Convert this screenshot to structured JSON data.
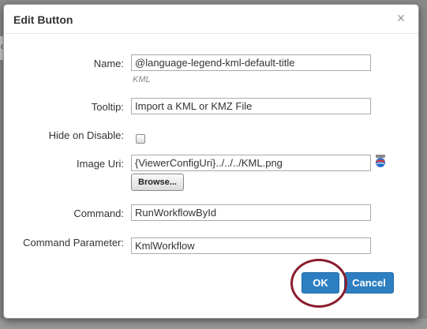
{
  "dialog": {
    "title": "Edit Button",
    "close_glyph": "×"
  },
  "fields": {
    "name": {
      "label": "Name:",
      "value": "@language-legend-kml-default-title",
      "hint": "KML"
    },
    "tooltip": {
      "label": "Tooltip:",
      "value": "Import a KML or KMZ File"
    },
    "hide_on_disable": {
      "label": "Hide on Disable:",
      "checked": false
    },
    "image_uri": {
      "label": "Image Uri:",
      "value": "{ViewerConfigUri}../../../KML.png",
      "browse_label": "Browse..."
    },
    "command": {
      "label": "Command:",
      "value": "RunWorkflowById"
    },
    "command_parameter": {
      "label": "Command Parameter:",
      "value": "KmlWorkflow"
    }
  },
  "buttons": {
    "ok_label": "OK",
    "cancel_label": "Cancel"
  },
  "colors": {
    "primary_button": "#2d7fc2",
    "highlight_circle": "#8a1c2c"
  },
  "icons": {
    "close": "close-icon",
    "image_picker": "globe-icon"
  }
}
